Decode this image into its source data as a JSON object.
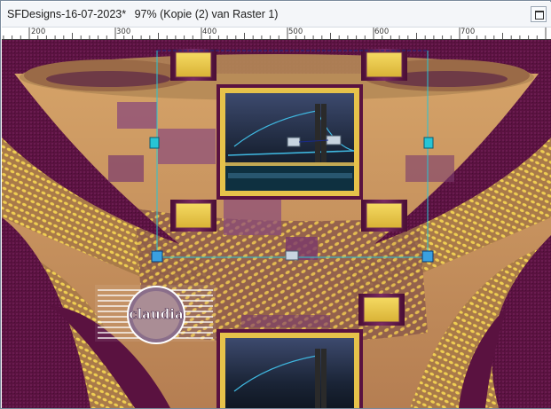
{
  "window": {
    "title": "SFDesigns-16-07-2023*",
    "zoom_label": "97% (Kopie (2) van Raster 1)"
  },
  "ruler": {
    "labels": [
      "200",
      "300",
      "400",
      "500",
      "600",
      "700"
    ]
  },
  "canvas": {
    "watermark_text": "claudia",
    "colors": {
      "purple": "#5a1240",
      "gold": "#e2c044",
      "tan": "#c48e5a",
      "selection": "#27c5d5"
    }
  }
}
